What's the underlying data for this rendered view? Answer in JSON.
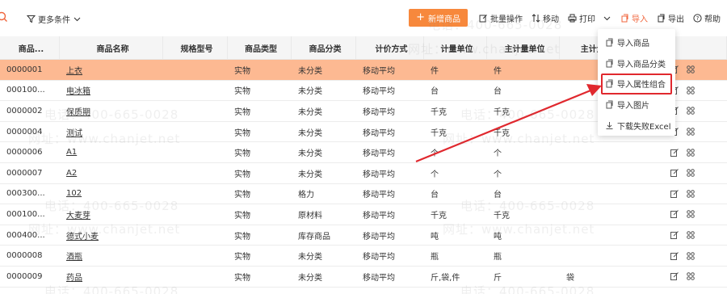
{
  "toolbar": {
    "filter_label": "更多条件",
    "add_label": "新增商品",
    "batch_label": "批量操作",
    "move_label": "移动",
    "print_label": "打印",
    "import_label": "导入",
    "export_label": "导出",
    "help_label": "帮助"
  },
  "table": {
    "headers": [
      "商品...",
      "商品名称",
      "规格型号",
      "商品类型",
      "商品分类",
      "计价方式",
      "计量单位",
      "主计量单位",
      "主计量条..."
    ],
    "rows": [
      {
        "code": "0000001",
        "name": "上衣",
        "spec": "",
        "type": "实物",
        "category": "未分类",
        "pricing": "移动平均",
        "unit": "件",
        "main_unit": "件",
        "main_barcode": ""
      },
      {
        "code": "000100...",
        "name": "电冰箱",
        "spec": "",
        "type": "实物",
        "category": "未分类",
        "pricing": "移动平均",
        "unit": "台",
        "main_unit": "台",
        "main_barcode": ""
      },
      {
        "code": "0000002",
        "name": "保质期",
        "spec": "",
        "type": "实物",
        "category": "未分类",
        "pricing": "移动平均",
        "unit": "千克",
        "main_unit": "千克",
        "main_barcode": ""
      },
      {
        "code": "0000004",
        "name": "测试",
        "spec": "",
        "type": "实物",
        "category": "未分类",
        "pricing": "移动平均",
        "unit": "千克",
        "main_unit": "千克",
        "main_barcode": ""
      },
      {
        "code": "0000006",
        "name": "A1",
        "spec": "",
        "type": "实物",
        "category": "未分类",
        "pricing": "移动平均",
        "unit": "个",
        "main_unit": "个",
        "main_barcode": ""
      },
      {
        "code": "0000007",
        "name": "A2",
        "spec": "",
        "type": "实物",
        "category": "未分类",
        "pricing": "移动平均",
        "unit": "个",
        "main_unit": "个",
        "main_barcode": ""
      },
      {
        "code": "000300...",
        "name": "102",
        "spec": "",
        "type": "实物",
        "category": "格力",
        "pricing": "移动平均",
        "unit": "台",
        "main_unit": "台",
        "main_barcode": ""
      },
      {
        "code": "000100...",
        "name": "大麦芽",
        "spec": "",
        "type": "实物",
        "category": "原材料",
        "pricing": "移动平均",
        "unit": "千克",
        "main_unit": "千克",
        "main_barcode": ""
      },
      {
        "code": "000400...",
        "name": "德式小麦",
        "spec": "",
        "type": "实物",
        "category": "库存商品",
        "pricing": "移动平均",
        "unit": "吨",
        "main_unit": "吨",
        "main_barcode": ""
      },
      {
        "code": "0000008",
        "name": "酒瓶",
        "spec": "",
        "type": "实物",
        "category": "未分类",
        "pricing": "移动平均",
        "unit": "瓶",
        "main_unit": "瓶",
        "main_barcode": ""
      },
      {
        "code": "0000009",
        "name": "药品",
        "spec": "",
        "type": "实物",
        "category": "未分类",
        "pricing": "移动平均",
        "unit": "斤,袋,件",
        "main_unit": "斤",
        "main_barcode": "袋"
      }
    ]
  },
  "dropdown": {
    "items": [
      "导入商品",
      "导入商品分类",
      "导入属性组合",
      "导入图片",
      "下载失败Excel"
    ]
  },
  "watermark": {
    "phone": "电话：400-665-0028",
    "site": "网址：www.chanjet.net"
  },
  "colors": {
    "accent": "#f7883c",
    "selected_row": "#fdb992",
    "highlight_box": "#e0282e",
    "arrow": "#e0282e"
  }
}
